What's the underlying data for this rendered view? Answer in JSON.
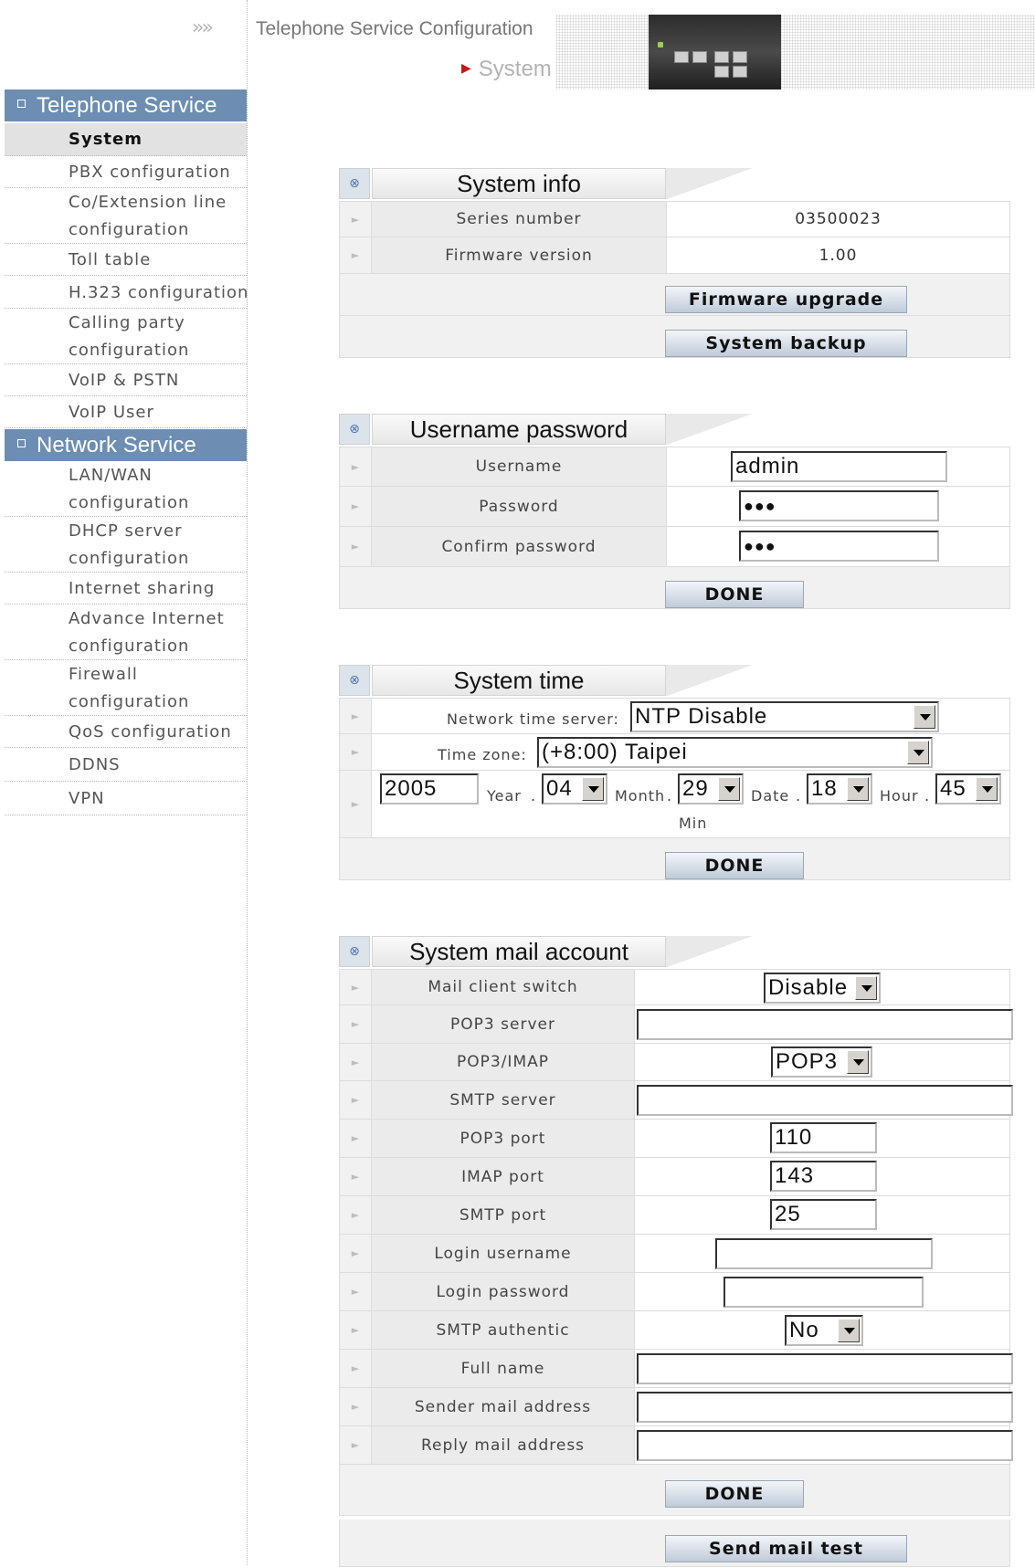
{
  "header": {
    "arrows": "»»",
    "title": "Telephone Service Configuration",
    "subtitle": "System"
  },
  "sidebar": {
    "telephone_header": "Telephone Service",
    "telephone_items": [
      "System",
      "PBX configuration",
      "Co/Extension line",
      "configuration",
      "Toll table",
      "H.323 configuration",
      "Calling party",
      "configuration",
      "VoIP & PSTN",
      "VoIP User"
    ],
    "network_header": "Network Service",
    "network_items": [
      "LAN/WAN",
      "configuration",
      "DHCP server",
      "configuration",
      "Internet sharing",
      "Advance Internet",
      "configuration",
      "Firewall",
      "configuration",
      "QoS configuration",
      "DDNS",
      "VPN"
    ]
  },
  "system_info": {
    "title": "System info",
    "series_label": "Series number",
    "series_value": "03500023",
    "firmware_label": "Firmware version",
    "firmware_value": "1.00",
    "upgrade_button": "Firmware upgrade",
    "backup_button": "System backup"
  },
  "username_password": {
    "title": "Username password",
    "username_label": "Username",
    "username_value": "admin",
    "password_label": "Password",
    "password_value": "●●●",
    "confirm_label": "Confirm password",
    "confirm_value": "●●●",
    "done_button": "DONE"
  },
  "system_time": {
    "title": "System time",
    "ntp_label": "Network time server:",
    "ntp_value": "NTP Disable",
    "tz_label": "Time zone:",
    "tz_value": "(+8:00) Taipei",
    "year_value": "2005",
    "year_label": "Year",
    "month_value": "04",
    "month_label": "Month",
    "date_value": "29",
    "date_label": "Date",
    "hour_value": "18",
    "hour_label": "Hour",
    "min_value": "45",
    "min_label": "Min",
    "dot": ".",
    "done_button": "DONE"
  },
  "mail": {
    "title": "System mail account",
    "switch_label": "Mail client switch",
    "switch_value": "Disable",
    "pop3_server_label": "POP3 server",
    "pop3_server_value": "",
    "pop3imap_label": "POP3/IMAP",
    "pop3imap_value": "POP3",
    "smtp_server_label": "SMTP server",
    "smtp_server_value": "",
    "pop3_port_label": "POP3 port",
    "pop3_port_value": "110",
    "imap_port_label": "IMAP port",
    "imap_port_value": "143",
    "smtp_port_label": "SMTP port",
    "smtp_port_value": "25",
    "login_user_label": "Login username",
    "login_user_value": "",
    "login_pass_label": "Login password",
    "login_pass_value": "",
    "smtp_auth_label": "SMTP authentic",
    "smtp_auth_value": "No",
    "full_name_label": "Full name",
    "full_name_value": "",
    "sender_label": "Sender mail address",
    "sender_value": "",
    "reply_label": "Reply mail address",
    "reply_value": "",
    "done_button": "DONE",
    "test_button": "Send mail test"
  }
}
